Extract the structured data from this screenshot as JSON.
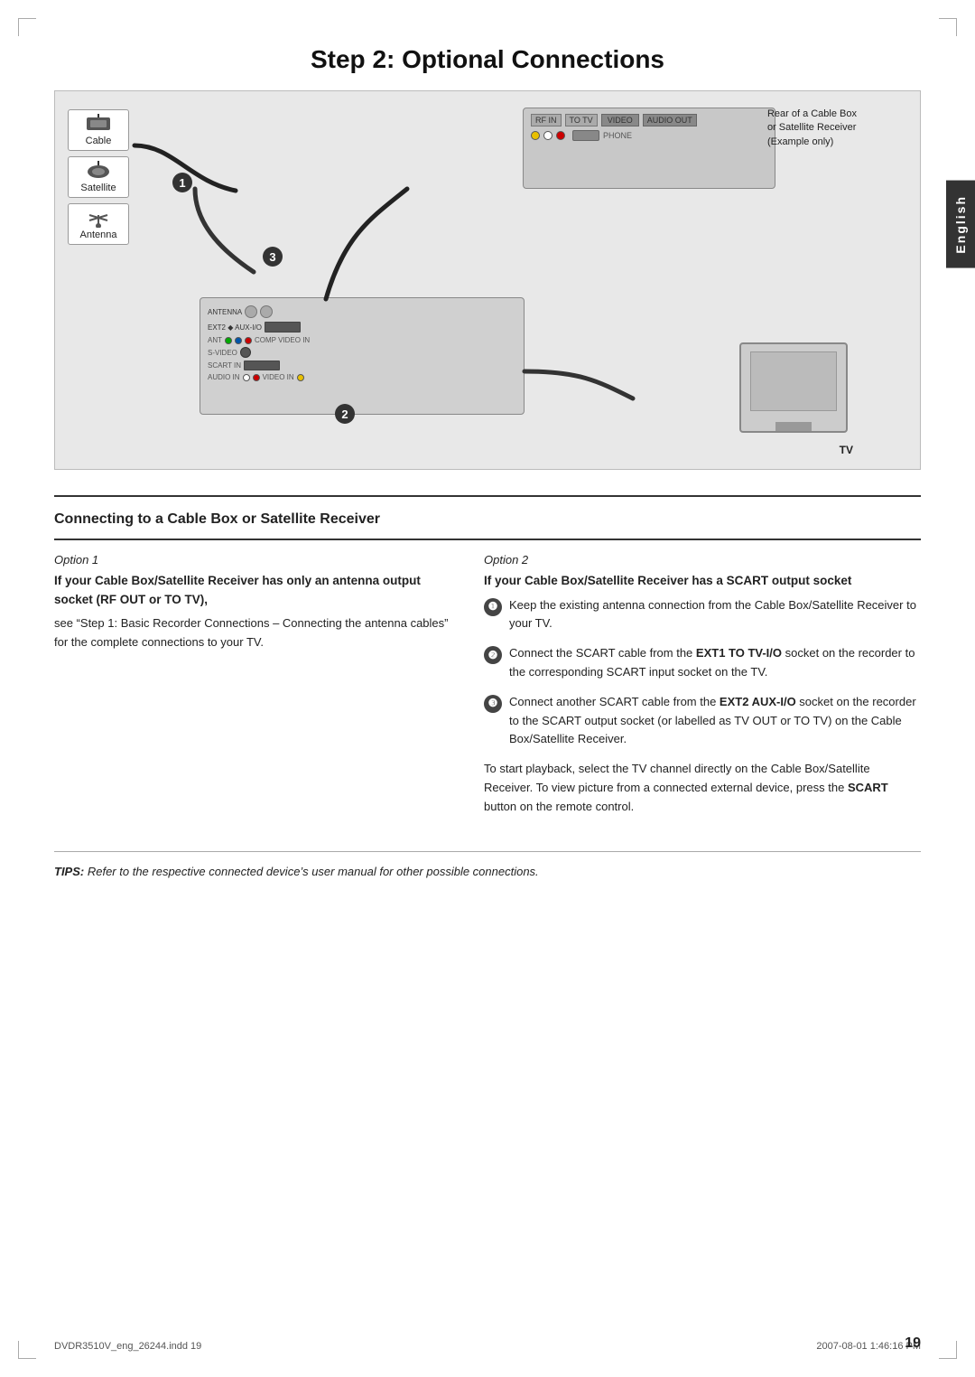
{
  "page": {
    "title": "Step 2: Optional Connections",
    "number": "19",
    "footer_left": "DVDR3510V_eng_26244.indd  19",
    "footer_right": "2007-08-01  1:46:16 PM"
  },
  "english_tab": "English",
  "diagram": {
    "label_rear": "Rear of a Cable Box",
    "label_or": "or Satellite Receiver",
    "label_example": "(Example only)",
    "label_tv": "TV",
    "num1": "1",
    "num2": "2",
    "num3": "3"
  },
  "left_icons": [
    {
      "label": "Cable"
    },
    {
      "label": "Satellite"
    },
    {
      "label": "Antenna"
    }
  ],
  "section_heading": "Connecting to a Cable Box or Satellite Receiver",
  "col_left": {
    "option_label": "Option 1",
    "sub_heading": "If your Cable Box/Satellite Receiver has only an antenna output socket (RF OUT or TO TV),",
    "body_text": "see “Step 1: Basic Recorder Connections – Connecting the antenna cables” for the complete connections to your TV."
  },
  "col_right": {
    "option_label": "Option 2",
    "sub_heading": "If your Cable Box/Satellite Receiver has a SCART output socket",
    "items": [
      {
        "num": "1",
        "text": "Keep the existing antenna connection from the Cable Box/Satellite Receiver to your TV."
      },
      {
        "num": "2",
        "text_plain": "Connect the SCART cable from the ",
        "text_bold": "EXT1 TO TV-I/O",
        "text_plain2": " socket on the recorder to the corresponding SCART input socket on the TV."
      },
      {
        "num": "3",
        "text_plain": "Connect another SCART cable from the ",
        "text_bold": "EXT2 AUX-I/O",
        "text_plain2": " socket on the recorder to the SCART output socket (or labelled as TV OUT or TO TV) on the Cable Box/Satellite Receiver."
      }
    ],
    "closing_text_plain": "To start playback, select the TV channel directly on the Cable Box/Satellite Receiver. To view picture from a connected external device, press the ",
    "closing_text_bold": "SCART",
    "closing_text_end": " button on the remote control."
  },
  "tips": {
    "prefix": "TIPS:",
    "text": "  Refer to the respective connected device’s user manual for other possible connections."
  }
}
